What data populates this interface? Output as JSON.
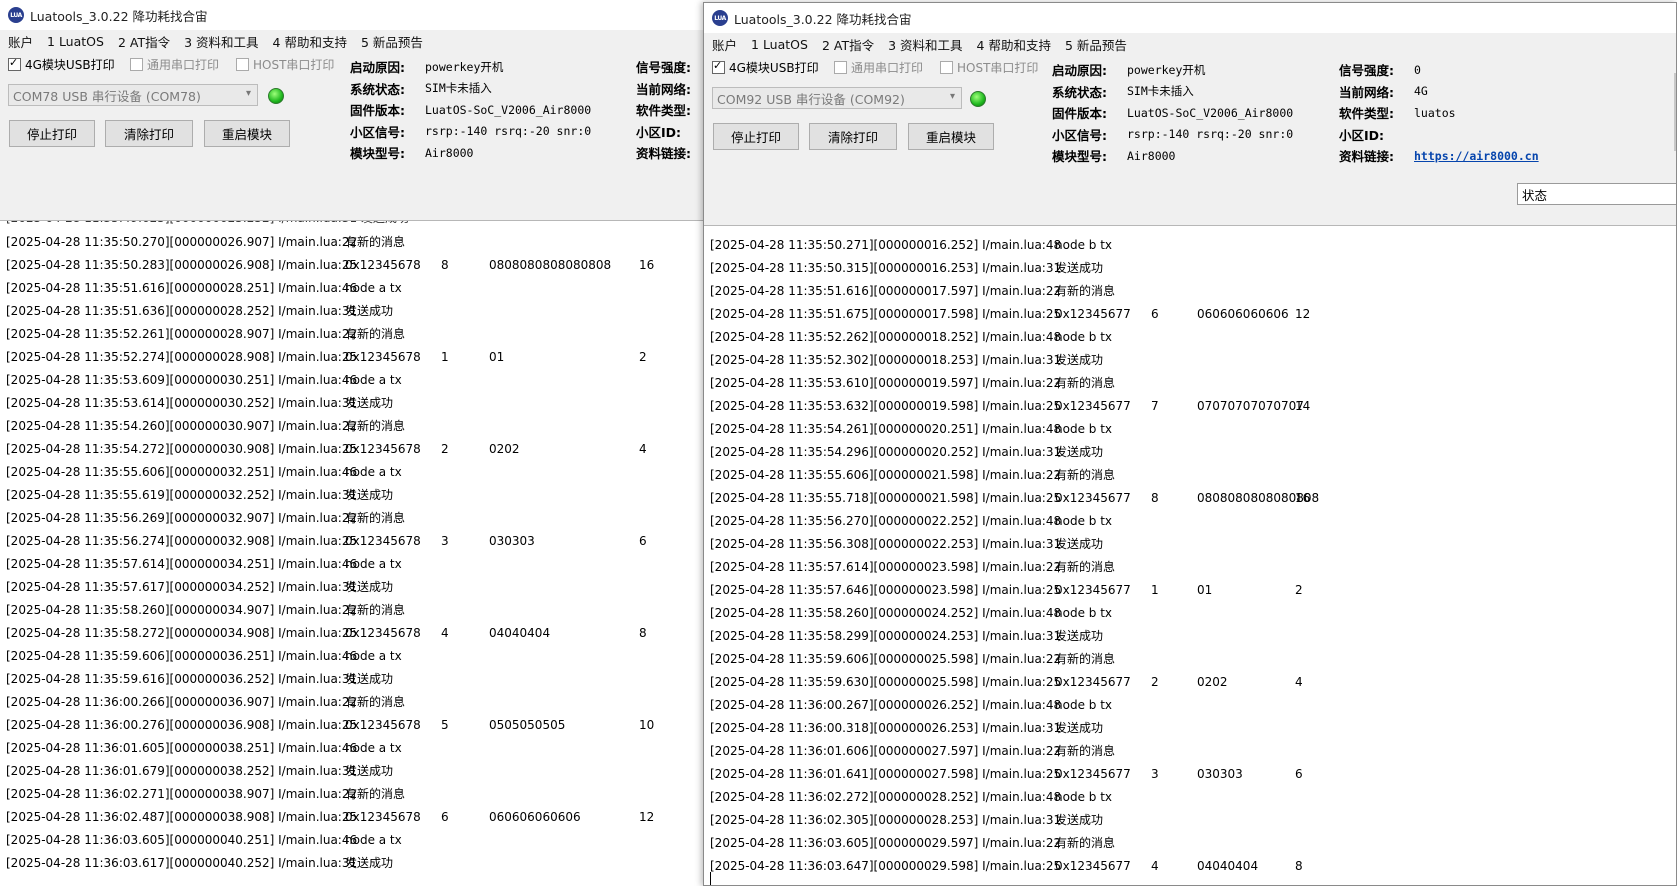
{
  "left": {
    "title": "Luatools_3.0.22 降功耗找合宙",
    "menu": [
      "账户",
      "1 LuatOS",
      "2 AT指令",
      "3 资料和工具",
      "4 帮助和支持",
      "5 新品预告"
    ],
    "checkboxes": {
      "usb": "4G模块USB打印",
      "serial": "通用串口打印",
      "host": "HOST串口打印"
    },
    "port": "COM78 USB 串行设备 (COM78)",
    "buttons": {
      "stop": "停止打印",
      "clear": "清除打印",
      "restart": "重启模块"
    },
    "info": [
      {
        "k": "启动原因:",
        "v": "powerkey开机"
      },
      {
        "k": "系统状态:",
        "v": "SIM卡未插入"
      },
      {
        "k": "固件版本:",
        "v": "LuatOS-SoC_V2006_Air8000"
      },
      {
        "k": "小区信号:",
        "v": "rsrp:-140 rsrq:-20 snr:0"
      },
      {
        "k": "模块型号:",
        "v": "Air8000"
      }
    ],
    "info2": [
      "信号强度:",
      "当前网络:",
      "软件类型:",
      "小区ID:",
      "资料链接:"
    ],
    "partial_line": "[2025-04-28 11:35:49.625][000000025.252] I/main.lua:31   发送成功",
    "log": [
      [
        "[2025-04-28 11:35:50.270][000000026.907] I/main.lua:22",
        "有新的消息",
        "",
        "",
        ""
      ],
      [
        "[2025-04-28 11:35:50.283][000000026.908] I/main.lua:25",
        "0x12345678",
        "8",
        "0808080808080808",
        "16"
      ],
      [
        "[2025-04-28 11:35:51.616][000000028.251] I/main.lua:46",
        "node a tx",
        "",
        "",
        ""
      ],
      [
        "[2025-04-28 11:35:51.636][000000028.252] I/main.lua:31",
        "发送成功",
        "",
        "",
        ""
      ],
      [
        "[2025-04-28 11:35:52.261][000000028.907] I/main.lua:22",
        "有新的消息",
        "",
        "",
        ""
      ],
      [
        "[2025-04-28 11:35:52.274][000000028.908] I/main.lua:25",
        "0x12345678",
        "1",
        "01",
        "2"
      ],
      [
        "[2025-04-28 11:35:53.609][000000030.251] I/main.lua:46",
        "node a tx",
        "",
        "",
        ""
      ],
      [
        "[2025-04-28 11:35:53.614][000000030.252] I/main.lua:31",
        "发送成功",
        "",
        "",
        ""
      ],
      [
        "[2025-04-28 11:35:54.260][000000030.907] I/main.lua:22",
        "有新的消息",
        "",
        "",
        ""
      ],
      [
        "[2025-04-28 11:35:54.272][000000030.908] I/main.lua:25",
        "0x12345678",
        "2",
        "0202",
        "4"
      ],
      [
        "[2025-04-28 11:35:55.606][000000032.251] I/main.lua:46",
        "node a tx",
        "",
        "",
        ""
      ],
      [
        "[2025-04-28 11:35:55.619][000000032.252] I/main.lua:31",
        "发送成功",
        "",
        "",
        ""
      ],
      [
        "[2025-04-28 11:35:56.269][000000032.907] I/main.lua:22",
        "有新的消息",
        "",
        "",
        ""
      ],
      [
        "[2025-04-28 11:35:56.274][000000032.908] I/main.lua:25",
        "0x12345678",
        "3",
        "030303",
        "6"
      ],
      [
        "[2025-04-28 11:35:57.614][000000034.251] I/main.lua:46",
        "node a tx",
        "",
        "",
        ""
      ],
      [
        "[2025-04-28 11:35:57.617][000000034.252] I/main.lua:31",
        "发送成功",
        "",
        "",
        ""
      ],
      [
        "[2025-04-28 11:35:58.260][000000034.907] I/main.lua:22",
        "有新的消息",
        "",
        "",
        ""
      ],
      [
        "[2025-04-28 11:35:58.272][000000034.908] I/main.lua:25",
        "0x12345678",
        "4",
        "04040404",
        "8"
      ],
      [
        "[2025-04-28 11:35:59.606][000000036.251] I/main.lua:46",
        "node a tx",
        "",
        "",
        ""
      ],
      [
        "[2025-04-28 11:35:59.616][000000036.252] I/main.lua:31",
        "发送成功",
        "",
        "",
        ""
      ],
      [
        "[2025-04-28 11:36:00.266][000000036.907] I/main.lua:22",
        "有新的消息",
        "",
        "",
        ""
      ],
      [
        "[2025-04-28 11:36:00.276][000000036.908] I/main.lua:25",
        "0x12345678",
        "5",
        "0505050505",
        "10"
      ],
      [
        "[2025-04-28 11:36:01.605][000000038.251] I/main.lua:46",
        "node a tx",
        "",
        "",
        ""
      ],
      [
        "[2025-04-28 11:36:01.679][000000038.252] I/main.lua:31",
        "发送成功",
        "",
        "",
        ""
      ],
      [
        "[2025-04-28 11:36:02.271][000000038.907] I/main.lua:22",
        "有新的消息",
        "",
        "",
        ""
      ],
      [
        "[2025-04-28 11:36:02.487][000000038.908] I/main.lua:25",
        "0x12345678",
        "6",
        "060606060606",
        "12"
      ],
      [
        "[2025-04-28 11:36:03.605][000000040.251] I/main.lua:46",
        "node a tx",
        "",
        "",
        ""
      ],
      [
        "[2025-04-28 11:36:03.617][000000040.252] I/main.lua:31",
        "发送成功",
        "",
        "",
        ""
      ]
    ]
  },
  "right": {
    "title": "Luatools_3.0.22 降功耗找合宙",
    "menu": [
      "账户",
      "1 LuatOS",
      "2 AT指令",
      "3 资料和工具",
      "4 帮助和支持",
      "5 新品预告"
    ],
    "checkboxes": {
      "usb": "4G模块USB打印",
      "serial": "通用串口打印",
      "host": "HOST串口打印"
    },
    "port": "COM92 USB 串行设备 (COM92)",
    "buttons": {
      "stop": "停止打印",
      "clear": "清除打印",
      "restart": "重启模块"
    },
    "info": [
      {
        "k": "启动原因:",
        "v": "powerkey开机"
      },
      {
        "k": "系统状态:",
        "v": "SIM卡未插入"
      },
      {
        "k": "固件版本:",
        "v": "LuatOS-SoC_V2006_Air8000"
      },
      {
        "k": "小区信号:",
        "v": "rsrp:-140 rsrq:-20 snr:0"
      },
      {
        "k": "模块型号:",
        "v": "Air8000"
      }
    ],
    "info2": [
      {
        "k": "信号强度:",
        "v": "0"
      },
      {
        "k": "当前网络:",
        "v": "4G"
      },
      {
        "k": "软件类型:",
        "v": "luatos"
      },
      {
        "k": "小区ID:",
        "v": ""
      },
      {
        "k": "资料链接:",
        "v": "https://air8000.cn"
      }
    ],
    "status_field": "状态",
    "log": [
      [
        "[2025-04-28 11:35:50.271][000000016.252] I/main.lua:48",
        "node b tx",
        "",
        "",
        ""
      ],
      [
        "[2025-04-28 11:35:50.315][000000016.253] I/main.lua:31",
        "发送成功",
        "",
        "",
        ""
      ],
      [
        "[2025-04-28 11:35:51.616][000000017.597] I/main.lua:22",
        "有新的消息",
        "",
        "",
        ""
      ],
      [
        "[2025-04-28 11:35:51.675][000000017.598] I/main.lua:25",
        "0x12345677",
        "6",
        "060606060606",
        "12"
      ],
      [
        "[2025-04-28 11:35:52.262][000000018.252] I/main.lua:48",
        "node b tx",
        "",
        "",
        ""
      ],
      [
        "[2025-04-28 11:35:52.302][000000018.253] I/main.lua:31",
        "发送成功",
        "",
        "",
        ""
      ],
      [
        "[2025-04-28 11:35:53.610][000000019.597] I/main.lua:22",
        "有新的消息",
        "",
        "",
        ""
      ],
      [
        "[2025-04-28 11:35:53.632][000000019.598] I/main.lua:25",
        "0x12345677",
        "7",
        "07070707070707",
        "14"
      ],
      [
        "[2025-04-28 11:35:54.261][000000020.251] I/main.lua:48",
        "node b tx",
        "",
        "",
        ""
      ],
      [
        "[2025-04-28 11:35:54.296][000000020.252] I/main.lua:31",
        "发送成功",
        "",
        "",
        ""
      ],
      [
        "[2025-04-28 11:35:55.606][000000021.598] I/main.lua:22",
        "有新的消息",
        "",
        "",
        ""
      ],
      [
        "[2025-04-28 11:35:55.718][000000021.598] I/main.lua:25",
        "0x12345677",
        "8",
        "0808080808080808",
        "16"
      ],
      [
        "[2025-04-28 11:35:56.270][000000022.252] I/main.lua:48",
        "node b tx",
        "",
        "",
        ""
      ],
      [
        "[2025-04-28 11:35:56.308][000000022.253] I/main.lua:31",
        "发送成功",
        "",
        "",
        ""
      ],
      [
        "[2025-04-28 11:35:57.614][000000023.598] I/main.lua:22",
        "有新的消息",
        "",
        "",
        ""
      ],
      [
        "[2025-04-28 11:35:57.646][000000023.598] I/main.lua:25",
        "0x12345677",
        "1",
        "01",
        "2"
      ],
      [
        "[2025-04-28 11:35:58.260][000000024.252] I/main.lua:48",
        "node b tx",
        "",
        "",
        ""
      ],
      [
        "[2025-04-28 11:35:58.299][000000024.253] I/main.lua:31",
        "发送成功",
        "",
        "",
        ""
      ],
      [
        "[2025-04-28 11:35:59.606][000000025.598] I/main.lua:22",
        "有新的消息",
        "",
        "",
        ""
      ],
      [
        "[2025-04-28 11:35:59.630][000000025.598] I/main.lua:25",
        "0x12345677",
        "2",
        "0202",
        "4"
      ],
      [
        "[2025-04-28 11:36:00.267][000000026.252] I/main.lua:48",
        "node b tx",
        "",
        "",
        ""
      ],
      [
        "[2025-04-28 11:36:00.318][000000026.253] I/main.lua:31",
        "发送成功",
        "",
        "",
        ""
      ],
      [
        "[2025-04-28 11:36:01.606][000000027.597] I/main.lua:22",
        "有新的消息",
        "",
        "",
        ""
      ],
      [
        "[2025-04-28 11:36:01.641][000000027.598] I/main.lua:25",
        "0x12345677",
        "3",
        "030303",
        "6"
      ],
      [
        "[2025-04-28 11:36:02.272][000000028.252] I/main.lua:48",
        "node b tx",
        "",
        "",
        ""
      ],
      [
        "[2025-04-28 11:36:02.305][000000028.253] I/main.lua:31",
        "发送成功",
        "",
        "",
        ""
      ],
      [
        "[2025-04-28 11:36:03.605][000000029.597] I/main.lua:22",
        "有新的消息",
        "",
        "",
        ""
      ],
      [
        "[2025-04-28 11:36:03.647][000000029.598] I/main.lua:25",
        "0x12345677",
        "4",
        "04040404",
        "8"
      ]
    ]
  }
}
